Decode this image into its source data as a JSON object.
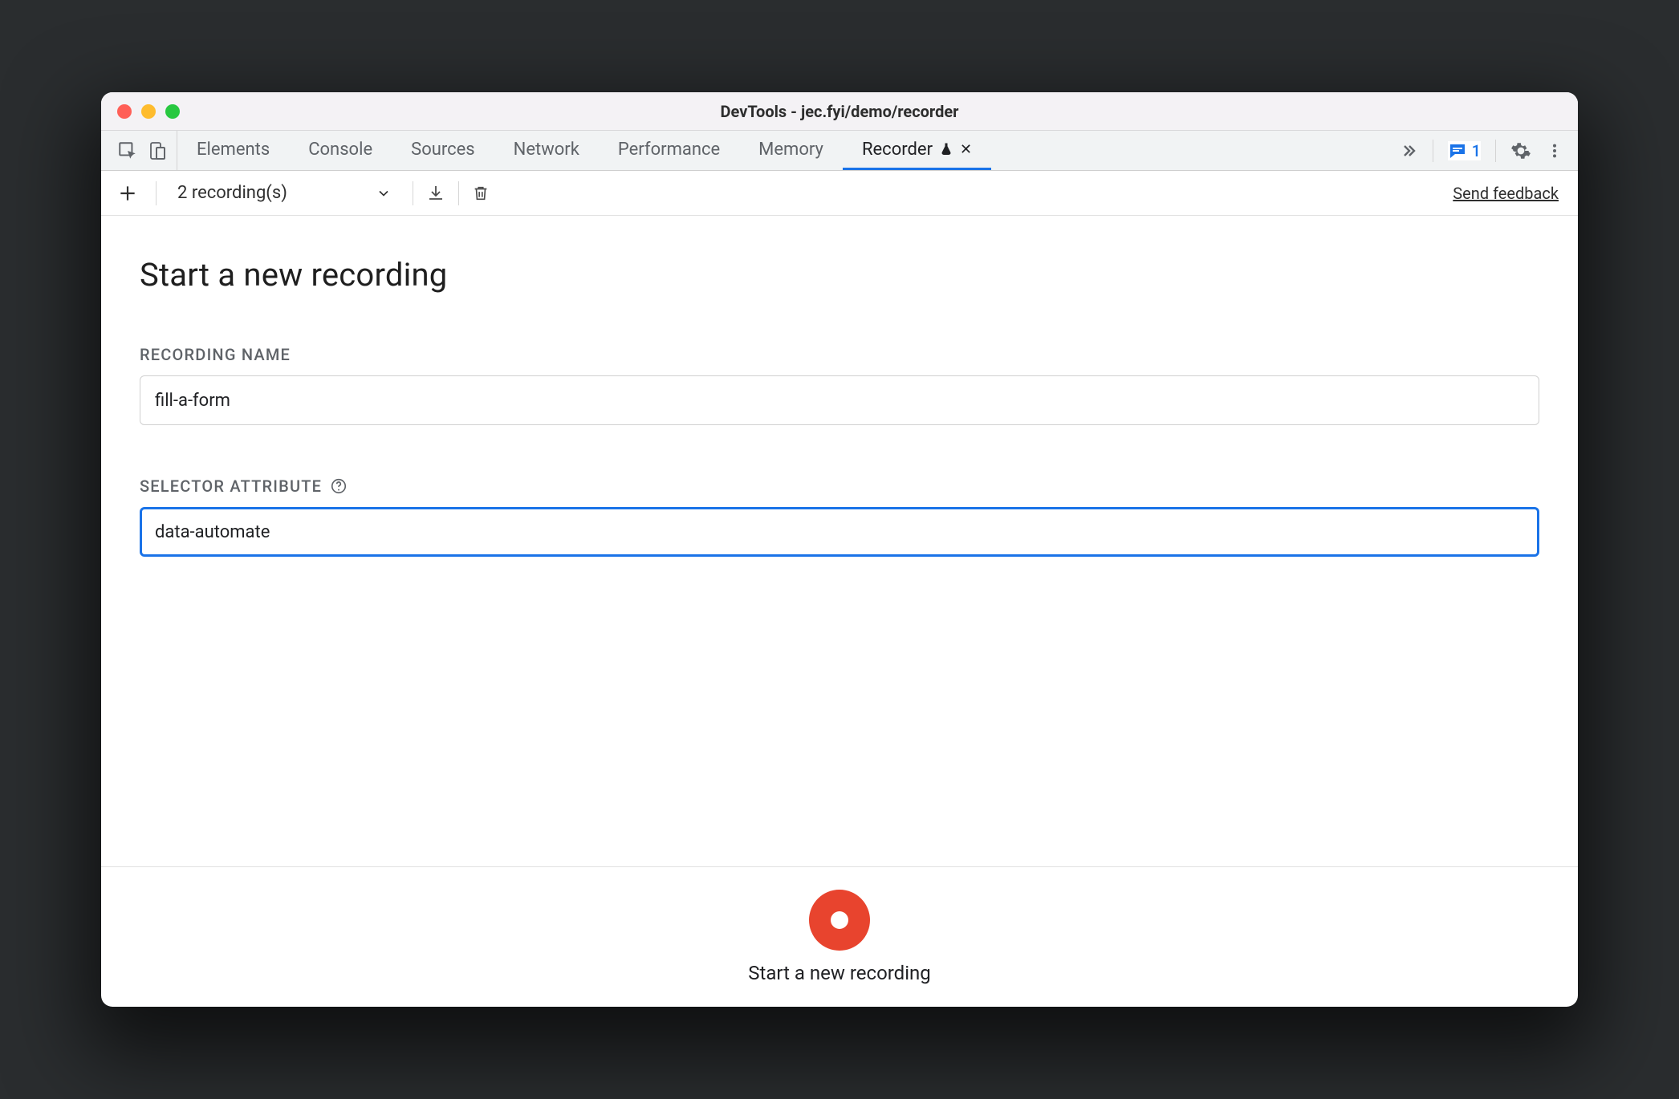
{
  "window": {
    "title": "DevTools - jec.fyi/demo/recorder"
  },
  "tabs": {
    "items": [
      {
        "label": "Elements",
        "active": false
      },
      {
        "label": "Console",
        "active": false
      },
      {
        "label": "Sources",
        "active": false
      },
      {
        "label": "Network",
        "active": false
      },
      {
        "label": "Performance",
        "active": false
      },
      {
        "label": "Memory",
        "active": false
      },
      {
        "label": "Recorder",
        "active": true,
        "experiment": true,
        "closable": true
      }
    ],
    "issues_count": "1"
  },
  "toolbar": {
    "recordings_label": "2 recording(s)",
    "feedback_label": "Send feedback"
  },
  "page": {
    "title": "Start a new recording",
    "recording_name_label": "RECORDING NAME",
    "recording_name_value": "fill-a-form",
    "selector_attr_label": "SELECTOR ATTRIBUTE",
    "selector_attr_value": "data-automate"
  },
  "footer": {
    "start_label": "Start a new recording"
  }
}
